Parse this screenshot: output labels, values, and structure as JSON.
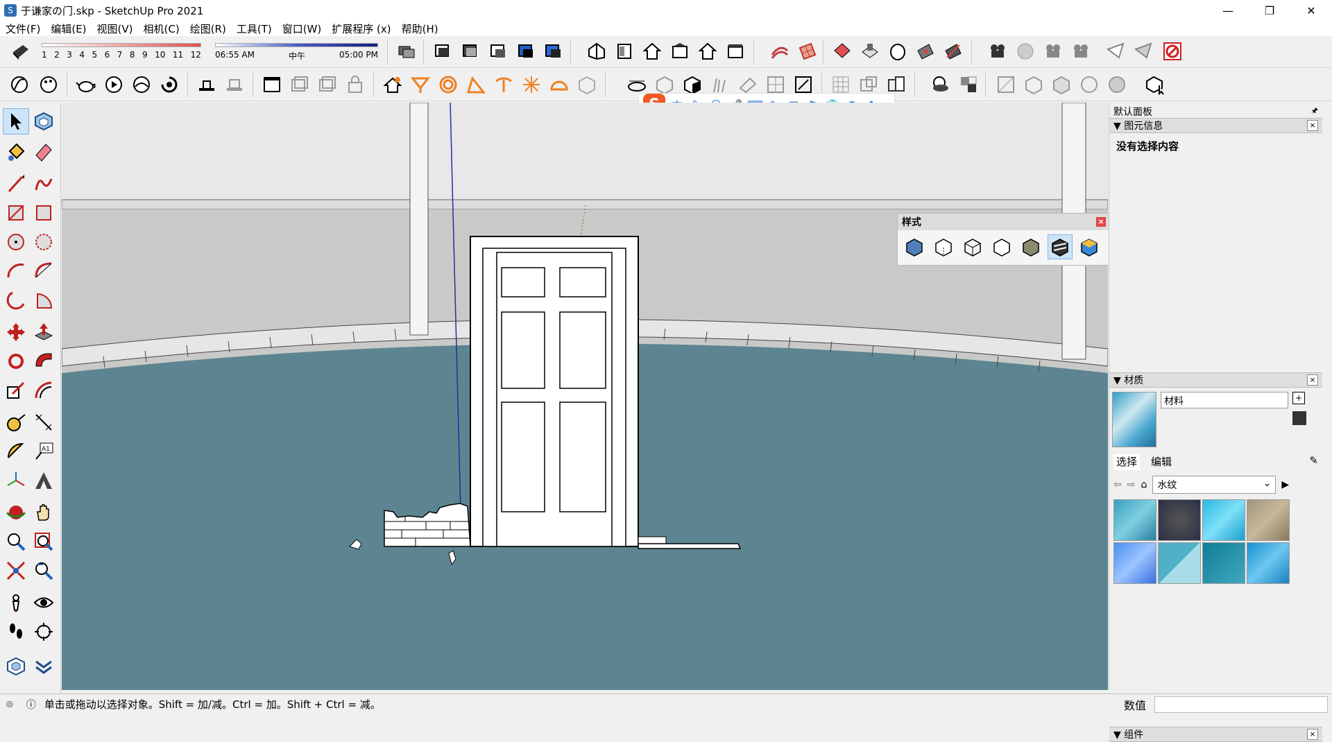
{
  "window": {
    "title": "于谦家の门.skp - SketchUp Pro 2021",
    "minimize": "—",
    "maximize": "❐",
    "close": "✕"
  },
  "menu": [
    "文件(F)",
    "编辑(E)",
    "视图(V)",
    "相机(C)",
    "绘图(R)",
    "工具(T)",
    "窗口(W)",
    "扩展程序 (x)",
    "帮助(H)"
  ],
  "shadow": {
    "months": [
      "1",
      "2",
      "3",
      "4",
      "5",
      "6",
      "7",
      "8",
      "9",
      "10",
      "11",
      "12"
    ],
    "time_start": "06:55 AM",
    "time_mid": "中午",
    "time_end": "05:00 PM"
  },
  "ime": {
    "logo": "S",
    "items": [
      "中",
      "°,",
      "☺",
      "🎤",
      "⌨",
      "✎",
      "▦",
      "⚑",
      "👕",
      "⚙",
      "✿"
    ]
  },
  "styles_window": {
    "title": "样式",
    "close": "×"
  },
  "right_panel": {
    "title": "默认面板",
    "pin": "🖈",
    "entity_info": {
      "header": "图元信息",
      "content": "没有选择内容"
    },
    "materials": {
      "header": "材质",
      "name": "材料",
      "tab_select": "选择",
      "tab_edit": "编辑",
      "library": "水纹",
      "swatch_colors": [
        "#3a9fbf",
        "#2b2f45",
        "#2ab8e0",
        "#a09680",
        "#4a8ef0",
        "#4fb0c8",
        "#0f7e95",
        "#1a90d0"
      ]
    },
    "components": {
      "header": "组件"
    }
  },
  "statusbar": {
    "text": "单击或拖动以选择对象。Shift = 加/减。Ctrl = 加。Shift + Ctrl = 减。",
    "measure_label": "数值"
  },
  "colors": {
    "ground": "#5d8591",
    "wall": "#c9cac8",
    "sky": "#e8e8e8",
    "accent": "#1f6fd6"
  }
}
